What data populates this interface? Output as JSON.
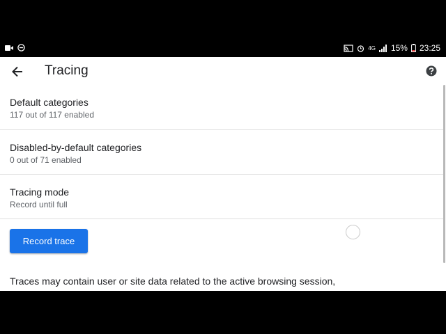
{
  "status_bar": {
    "network_label": "4G",
    "battery_percent": "15%",
    "time": "23:25"
  },
  "toolbar": {
    "title": "Tracing"
  },
  "preferences": [
    {
      "title": "Default categories",
      "summary": "117 out of 117 enabled"
    },
    {
      "title": "Disabled-by-default categories",
      "summary": "0 out of 71 enabled"
    },
    {
      "title": "Tracing mode",
      "summary": "Record until full"
    }
  ],
  "record_button": {
    "label": "Record trace"
  },
  "notice": {
    "text": "Traces may contain user or site data related to the active browsing session, including incognito tabs."
  },
  "colors": {
    "accent": "#1a73e8",
    "text_primary": "#202124",
    "text_secondary": "#5f6368"
  }
}
